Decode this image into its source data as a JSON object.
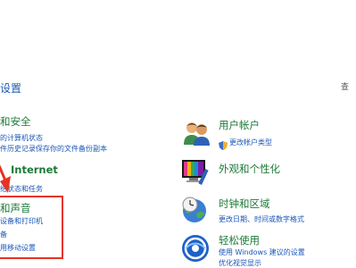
{
  "header": {
    "title": "设置",
    "view_by": "查"
  },
  "left_categories": [
    {
      "title": "和安全",
      "links": [
        "的计算机状态",
        "件历史记录保存你的文件备份副本"
      ]
    },
    {
      "title": "Internet",
      "links": [
        "络状态和任务"
      ]
    },
    {
      "title": "和声音",
      "links": [
        "设备和打印机",
        "备",
        "用移动设置"
      ]
    }
  ],
  "right_categories": [
    {
      "title": "用户帐户",
      "icon": "users-icon",
      "links": [
        "更改帐户类型"
      ]
    },
    {
      "title": "外观和个性化",
      "icon": "appearance-icon",
      "links": []
    },
    {
      "title": "时钟和区域",
      "icon": "clock-globe-icon",
      "links": [
        "更改日期、时间或数字格式"
      ]
    },
    {
      "title": "轻松使用",
      "icon": "ease-of-access-icon",
      "links": [
        "使用 Windows 建议的设置",
        "优化视觉显示"
      ]
    }
  ],
  "annotations": {
    "arrow_color": "#e63322",
    "box_color": "#e63322"
  }
}
